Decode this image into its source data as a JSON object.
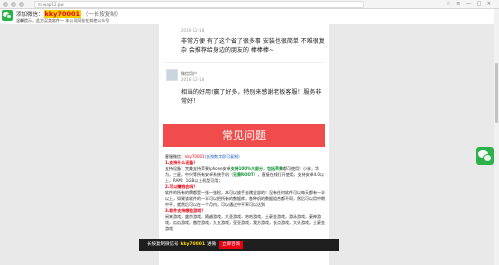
{
  "browser": {
    "url": "m.wap12.pw",
    "menu_glyphs": "☆ ≡ — □ ✕"
  },
  "promo": {
    "line1_prefix": "添加微信：",
    "wechat_id": "kky70001",
    "line1_tag": "（一长按复制）",
    "line2": "温馨提示，此方买卖软件一 本公司同存在其他公众号"
  },
  "comments": [
    {
      "date": "2016-12-18",
      "text": "非常方便 有了这个省了很多事 安装也很简单 不难很复杂 会推荐给身边的朋友的 棒棒棒~"
    },
    {
      "name": "微信用户",
      "date": "2016-12-18",
      "text": "相当的好用!赢了好多，特别来感谢老板客服！服务非常好！"
    }
  ],
  "faq": {
    "banner_title": "常见问题",
    "wx_line_prefix": "客服微信：",
    "wx_id": "kky70001",
    "wx_line_suffix": "(长按数字即可复制)",
    "q1": "1.支持什么设备？",
    "a1_pre": "支持设备：完美支持苹果iphone安卓",
    "a1_hl1": "支持100%大部分",
    "a1_mid": "，",
    "a1_hl2": "包括苹果",
    "a1_post": "都可使用！小米，华为，三星，中兴等所有安卓系统手机（",
    "a1_hl3": "无需ROOT",
    "a1_post2": "），直接在线打开使用，支持安卓4.0以上，RAM：1GB以上机型可用；",
    "q2": "2.可以赚钱会吗？",
    "a2": "软件的所有的牌都是一张一张检，本可以放手去赌全部的！沒有任何软件可以每天都有一半以上，如果该软件的一半可以把所有的数据库，各种机的数据组合都不同，然后可以用中期中平，就然后可以在一个月内，可以通过中平率可以达到",
    "q3": "3.软件支持哪些游戏？",
    "a3": "闲来游戏，盛京游戏，随越游戏，大圣游戏，哈哈游戏，土豪金游戏，游泳游戏，豪神游戏，瓜瓜游戏，傲世游戏，九五游戏，亚亚游戏，我方游戏，长点游戏，大头游戏，土豪金游戏"
  },
  "footer": {
    "prefix": "长按复制微信号",
    "wx_id": "kky70001",
    "suffix": "进微",
    "button": "立即咨询"
  },
  "colors": {
    "banner": "#f04c4c",
    "wechat_green": "#2bb34a",
    "highlight_yellow": "#f5d000",
    "accent_red": "#e60012"
  }
}
